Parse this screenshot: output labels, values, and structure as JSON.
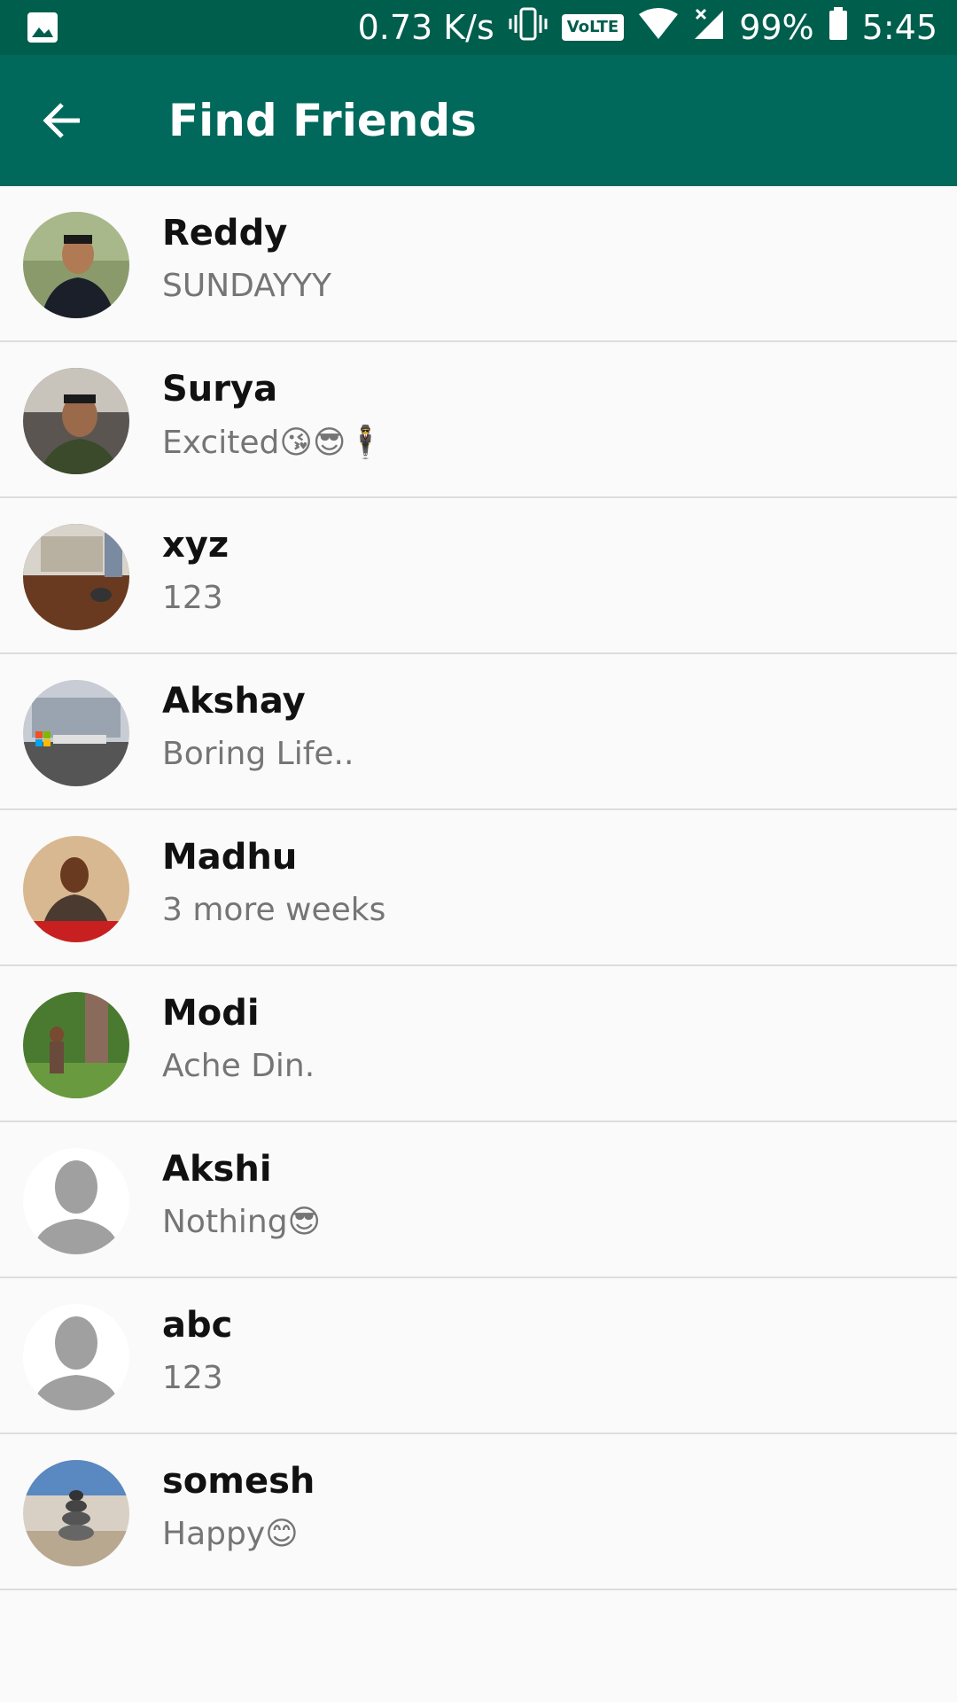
{
  "status_bar": {
    "image_icon": "image-icon",
    "net_speed": "0.73 K/s",
    "volte": "VoLTE",
    "battery": "99%",
    "time": "5:45"
  },
  "app_bar": {
    "title": "Find Friends",
    "back_icon": "arrow-back-icon",
    "color": "#00695c"
  },
  "friends": [
    {
      "name": "Reddy",
      "status": "SUNDAYYY"
    },
    {
      "name": "Surya",
      "status": "Excited😘😎🕴"
    },
    {
      "name": "xyz",
      "status": "123"
    },
    {
      "name": "Akshay",
      "status": "Boring Life.."
    },
    {
      "name": "Madhu",
      "status": "3 more weeks"
    },
    {
      "name": "Modi",
      "status": "Ache Din."
    },
    {
      "name": "Akshi",
      "status": "Nothing😎"
    },
    {
      "name": "abc",
      "status": "123"
    },
    {
      "name": "somesh",
      "status": "Happy😊"
    }
  ]
}
